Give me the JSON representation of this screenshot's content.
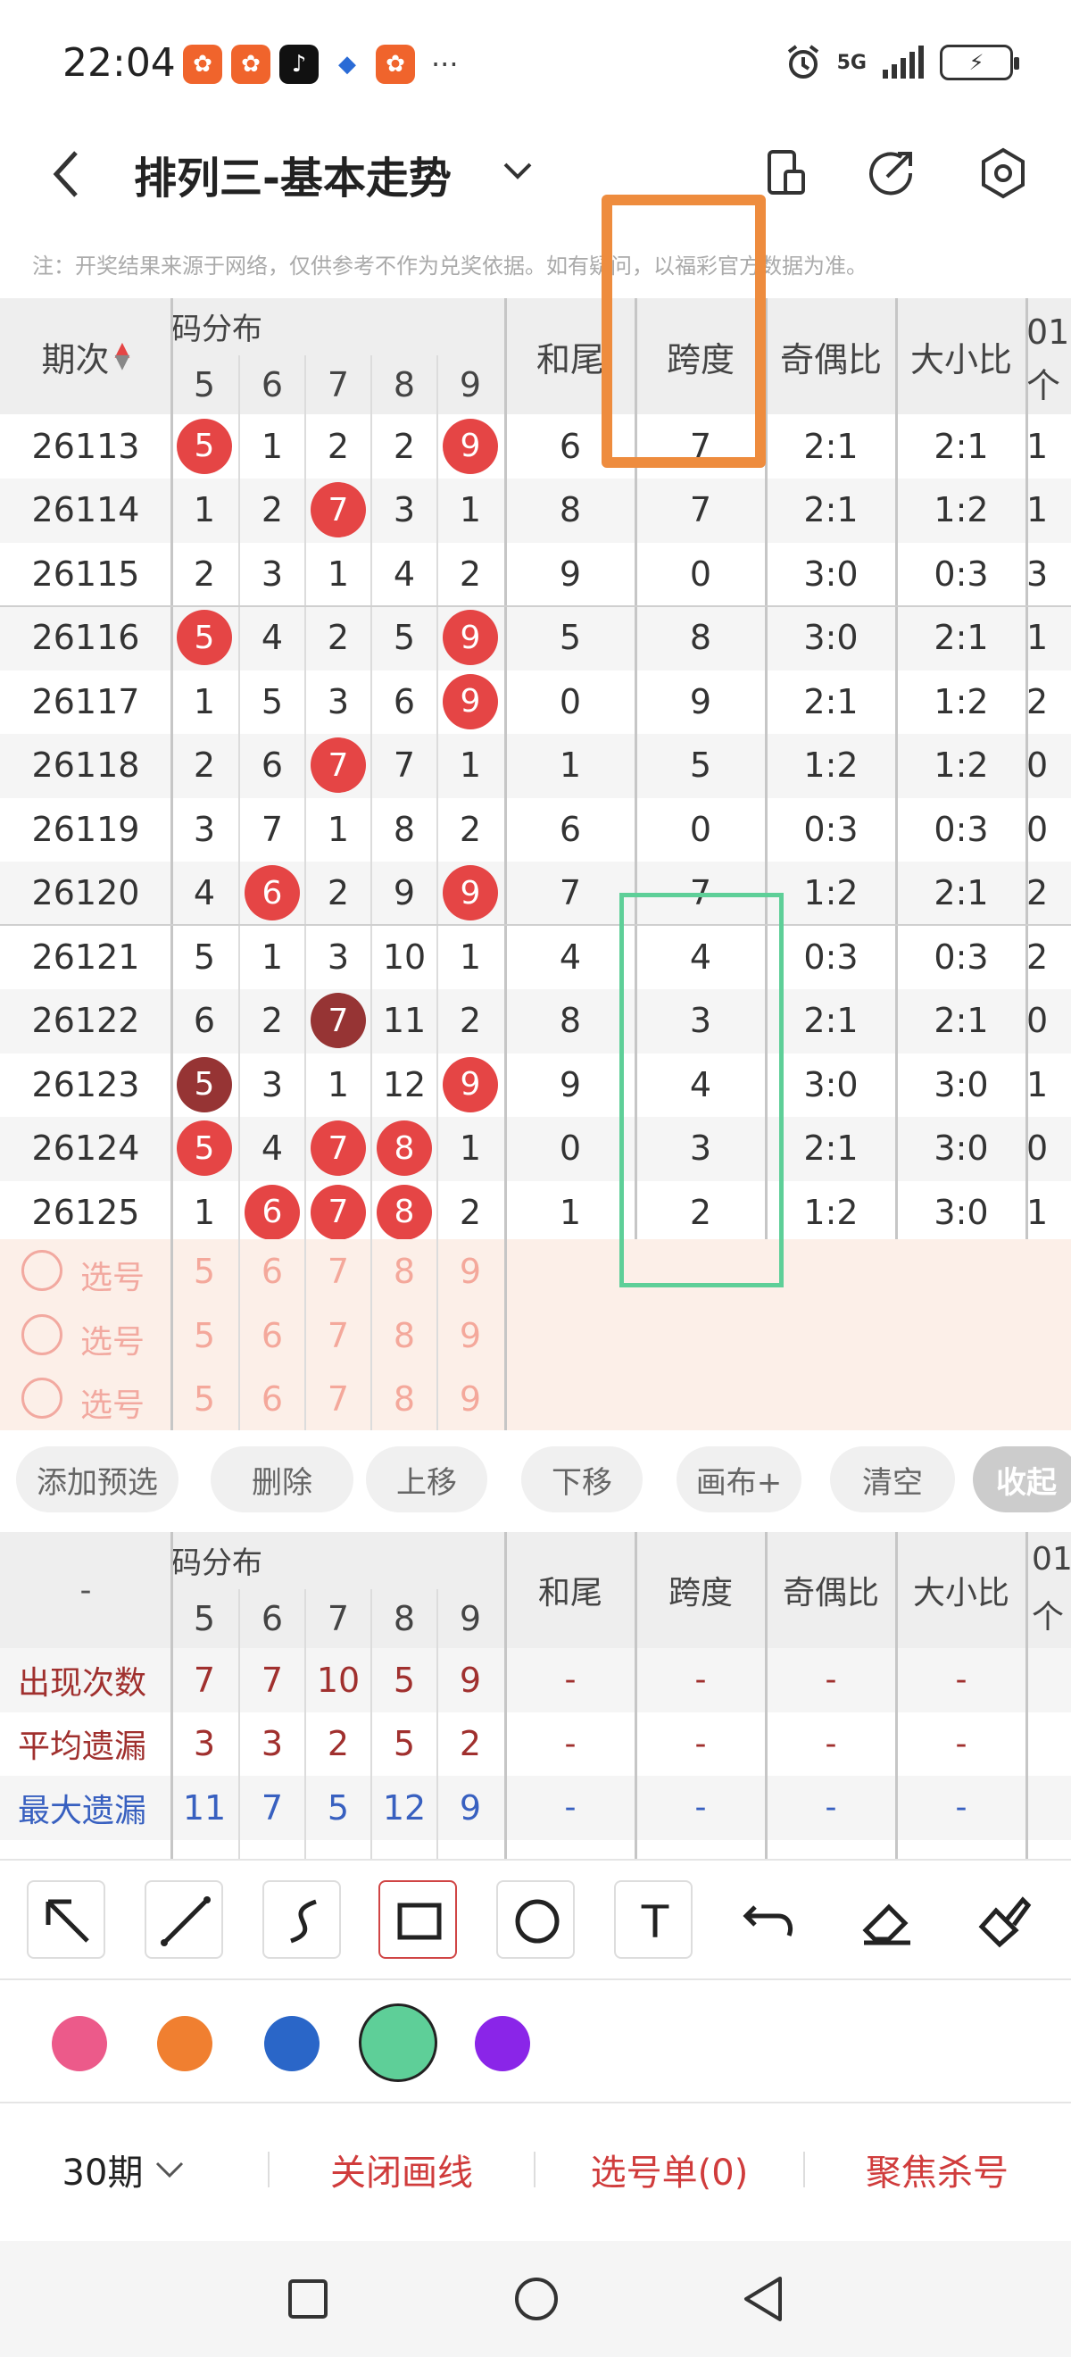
{
  "status": {
    "time": "22:04",
    "more": "···",
    "network": "5G",
    "battery": "⚡"
  },
  "header": {
    "title": "排列三-基本走势"
  },
  "notice": "注：开奖结果来源于网络，仅供参考不作为兑奖依据。如有疑问，以福彩官方数据为准。",
  "table": {
    "period_header": "期次",
    "group_header": "码分布",
    "digit_cols": [
      "5",
      "6",
      "7",
      "8",
      "9"
    ],
    "sum_tail_header": "和尾",
    "span_header": "跨度",
    "odd_even_header": "奇偶比",
    "big_small_header": "大小比",
    "extra_header_top": "01",
    "extra_header_bottom": "个",
    "rows": [
      {
        "period": "26113",
        "d": [
          "5",
          "1",
          "2",
          "2",
          "9"
        ],
        "hl": [
          1,
          0,
          0,
          0,
          1
        ],
        "tail": "6",
        "span": "7",
        "oe": "2:1",
        "bs": "2:1",
        "x": "1"
      },
      {
        "period": "26114",
        "d": [
          "1",
          "2",
          "7",
          "3",
          "1"
        ],
        "hl": [
          0,
          0,
          1,
          0,
          0
        ],
        "tail": "8",
        "span": "7",
        "oe": "2:1",
        "bs": "1:2",
        "x": "1"
      },
      {
        "period": "26115",
        "d": [
          "2",
          "3",
          "1",
          "4",
          "2"
        ],
        "hl": [
          0,
          0,
          0,
          0,
          0
        ],
        "tail": "9",
        "span": "0",
        "oe": "3:0",
        "bs": "0:3",
        "x": "3"
      },
      {
        "period": "26116",
        "d": [
          "5",
          "4",
          "2",
          "5",
          "9"
        ],
        "hl": [
          1,
          0,
          0,
          0,
          1
        ],
        "tail": "5",
        "span": "8",
        "oe": "3:0",
        "bs": "2:1",
        "x": "1"
      },
      {
        "period": "26117",
        "d": [
          "1",
          "5",
          "3",
          "6",
          "9"
        ],
        "hl": [
          0,
          0,
          0,
          0,
          1
        ],
        "tail": "0",
        "span": "9",
        "oe": "2:1",
        "bs": "1:2",
        "x": "2"
      },
      {
        "period": "26118",
        "d": [
          "2",
          "6",
          "7",
          "7",
          "1"
        ],
        "hl": [
          0,
          0,
          1,
          0,
          0
        ],
        "tail": "1",
        "span": "5",
        "oe": "1:2",
        "bs": "1:2",
        "x": "0"
      },
      {
        "period": "26119",
        "d": [
          "3",
          "7",
          "1",
          "8",
          "2"
        ],
        "hl": [
          0,
          0,
          0,
          0,
          0
        ],
        "tail": "6",
        "span": "0",
        "oe": "0:3",
        "bs": "0:3",
        "x": "0"
      },
      {
        "period": "26120",
        "d": [
          "4",
          "6",
          "2",
          "9",
          "9"
        ],
        "hl": [
          0,
          1,
          0,
          0,
          1
        ],
        "tail": "7",
        "span": "7",
        "oe": "1:2",
        "bs": "2:1",
        "x": "2"
      },
      {
        "period": "26121",
        "d": [
          "5",
          "1",
          "3",
          "10",
          "1"
        ],
        "hl": [
          0,
          0,
          0,
          0,
          0
        ],
        "tail": "4",
        "span": "4",
        "oe": "0:3",
        "bs": "0:3",
        "x": "2"
      },
      {
        "period": "26122",
        "d": [
          "6",
          "2",
          "7",
          "11",
          "2"
        ],
        "hl": [
          0,
          0,
          2,
          0,
          0
        ],
        "tail": "8",
        "span": "3",
        "oe": "2:1",
        "bs": "2:1",
        "x": "0"
      },
      {
        "period": "26123",
        "d": [
          "5",
          "3",
          "1",
          "12",
          "9"
        ],
        "hl": [
          2,
          0,
          0,
          0,
          1
        ],
        "tail": "9",
        "span": "4",
        "oe": "3:0",
        "bs": "3:0",
        "x": "1"
      },
      {
        "period": "26124",
        "d": [
          "5",
          "4",
          "7",
          "8",
          "1"
        ],
        "hl": [
          1,
          0,
          1,
          1,
          0
        ],
        "tail": "0",
        "span": "3",
        "oe": "2:1",
        "bs": "3:0",
        "x": "0"
      },
      {
        "period": "26125",
        "d": [
          "1",
          "6",
          "7",
          "8",
          "2"
        ],
        "hl": [
          0,
          1,
          1,
          1,
          0
        ],
        "tail": "1",
        "span": "2",
        "oe": "1:2",
        "bs": "3:0",
        "x": "1"
      }
    ],
    "select_label": "选号",
    "select_rows": 3
  },
  "actions": [
    "添加预选",
    "删除",
    "上移",
    "下移",
    "画布+",
    "清空",
    "收起"
  ],
  "stats": {
    "dash": "-",
    "rows": [
      {
        "label": "出现次数",
        "values": [
          "7",
          "7",
          "10",
          "5",
          "9"
        ],
        "color": "#a0302e"
      },
      {
        "label": "平均遗漏",
        "values": [
          "3",
          "3",
          "2",
          "5",
          "2"
        ],
        "color": "#a0302e"
      },
      {
        "label": "最大遗漏",
        "values": [
          "11",
          "7",
          "5",
          "12",
          "9"
        ],
        "color": "#3860c0"
      }
    ]
  },
  "draw_tools": [
    "arrow-tool",
    "line-tool",
    "curve-tool",
    "rectangle-tool",
    "circle-tool",
    "text-tool",
    "undo-tool",
    "eraser-tool",
    "clear-brush-tool"
  ],
  "text_tool_glyph": "T",
  "colors": [
    "#ec5a8a",
    "#f07f30",
    "#2a66c8",
    "#5ecf98",
    "#8a25e8"
  ],
  "bottom": {
    "periods": "30期",
    "close_lines": "关闭画线",
    "selection": "选号单(0)",
    "focus_kill": "聚焦杀号"
  }
}
